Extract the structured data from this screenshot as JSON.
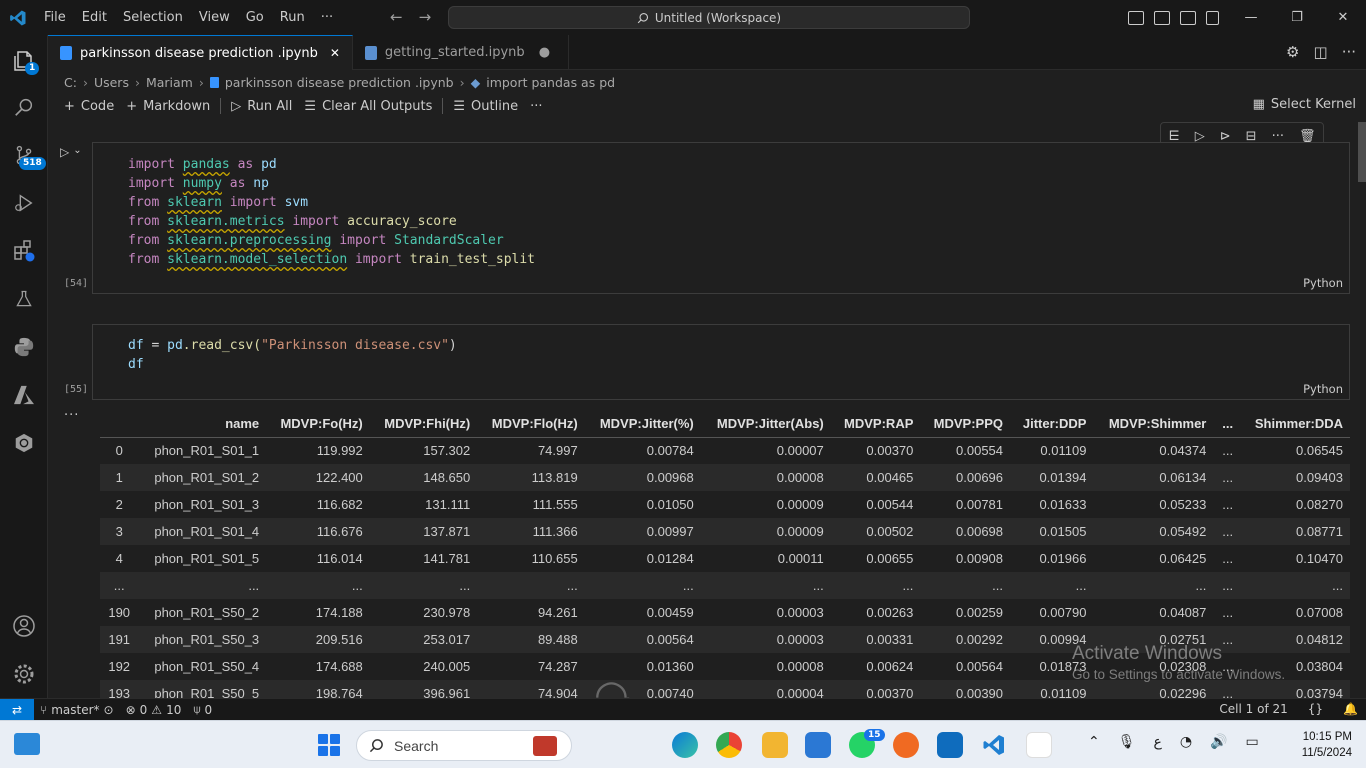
{
  "menu": [
    "File",
    "Edit",
    "Selection",
    "View",
    "Go",
    "Run",
    "···"
  ],
  "search": {
    "text": "Untitled (Workspace)"
  },
  "activity": {
    "explorer_badge": "1",
    "scm_badge": "518"
  },
  "tabs": [
    {
      "label": "parkinsson disease prediction .ipynb",
      "close": "✕"
    },
    {
      "label": "getting_started.ipynb",
      "dirty": "●"
    }
  ],
  "breadcrumb": [
    "C:",
    "Users",
    "Mariam",
    "parkinsson disease prediction .ipynb",
    "import pandas as pd"
  ],
  "toolbar": {
    "code": "Code",
    "markdown": "Markdown",
    "run_all": "Run All",
    "clear": "Clear All Outputs",
    "outline": "Outline",
    "more": "···",
    "kernel": "Select Kernel"
  },
  "cell1": {
    "exec": "[54]",
    "lang": "Python",
    "lines": [
      [
        "kw:import",
        "mod:pandas",
        "kw:as",
        "var:pd"
      ],
      [
        "kw:import",
        "mod:numpy",
        "kw:as",
        "var:np"
      ],
      [
        "kw:from",
        "mod:sklearn",
        "kw:import",
        "var:svm"
      ],
      [
        "kw:from",
        "mod:sklearn.metrics",
        "kw:import",
        "fn:accuracy_score"
      ],
      [
        "kw:from",
        "mod:sklearn.preprocessing",
        "kw:import",
        "mod2:StandardScaler"
      ],
      [
        "kw:from",
        "mod:sklearn.model_selection",
        "kw:import",
        "fn:train_test_split"
      ]
    ]
  },
  "cell2": {
    "exec": "[55]",
    "lang": "Python",
    "line1_var": "df",
    "line1_op": " = ",
    "line1_obj": "pd",
    "line1_fn": ".read_csv(",
    "line1_str": "\"Parkinsson disease.csv\"",
    "line1_end": ")",
    "line2": "df"
  },
  "output_more": "···",
  "table": {
    "headers": [
      "",
      "name",
      "MDVP:Fo(Hz)",
      "MDVP:Fhi(Hz)",
      "MDVP:Flo(Hz)",
      "MDVP:Jitter(%)",
      "MDVP:Jitter(Abs)",
      "MDVP:RAP",
      "MDVP:PPQ",
      "Jitter:DDP",
      "MDVP:Shimmer",
      "...",
      "Shimmer:DDA"
    ],
    "rows": [
      [
        "0",
        "phon_R01_S01_1",
        "119.992",
        "157.302",
        "74.997",
        "0.00784",
        "0.00007",
        "0.00370",
        "0.00554",
        "0.01109",
        "0.04374",
        "...",
        "0.06545"
      ],
      [
        "1",
        "phon_R01_S01_2",
        "122.400",
        "148.650",
        "113.819",
        "0.00968",
        "0.00008",
        "0.00465",
        "0.00696",
        "0.01394",
        "0.06134",
        "...",
        "0.09403"
      ],
      [
        "2",
        "phon_R01_S01_3",
        "116.682",
        "131.111",
        "111.555",
        "0.01050",
        "0.00009",
        "0.00544",
        "0.00781",
        "0.01633",
        "0.05233",
        "...",
        "0.08270"
      ],
      [
        "3",
        "phon_R01_S01_4",
        "116.676",
        "137.871",
        "111.366",
        "0.00997",
        "0.00009",
        "0.00502",
        "0.00698",
        "0.01505",
        "0.05492",
        "...",
        "0.08771"
      ],
      [
        "4",
        "phon_R01_S01_5",
        "116.014",
        "141.781",
        "110.655",
        "0.01284",
        "0.00011",
        "0.00655",
        "0.00908",
        "0.01966",
        "0.06425",
        "...",
        "0.10470"
      ],
      [
        "...",
        "...",
        "...",
        "...",
        "...",
        "...",
        "...",
        "...",
        "...",
        "...",
        "...",
        "...",
        "..."
      ],
      [
        "190",
        "phon_R01_S50_2",
        "174.188",
        "230.978",
        "94.261",
        "0.00459",
        "0.00003",
        "0.00263",
        "0.00259",
        "0.00790",
        "0.04087",
        "...",
        "0.07008"
      ],
      [
        "191",
        "phon_R01_S50_3",
        "209.516",
        "253.017",
        "89.488",
        "0.00564",
        "0.00003",
        "0.00331",
        "0.00292",
        "0.00994",
        "0.02751",
        "...",
        "0.04812"
      ],
      [
        "192",
        "phon_R01_S50_4",
        "174.688",
        "240.005",
        "74.287",
        "0.01360",
        "0.00008",
        "0.00624",
        "0.00564",
        "0.01873",
        "0.02308",
        "...",
        "0.03804"
      ],
      [
        "193",
        "phon_R01_S50_5",
        "198.764",
        "396.961",
        "74.904",
        "0.00740",
        "0.00004",
        "0.00370",
        "0.00390",
        "0.01109",
        "0.02296",
        "...",
        "0.03794"
      ]
    ]
  },
  "watermark": {
    "line1": "Activate Windows",
    "line2": "Go to Settings to activate Windows."
  },
  "status": {
    "branch": "master*",
    "problems": "0",
    "warnings": "10",
    "ports": "0",
    "cell": "Cell 1 of 21"
  },
  "taskbar": {
    "search": "Search",
    "whatsapp_badge": "15",
    "lang": "ع",
    "time": "10:15 PM",
    "date": "11/5/2024"
  },
  "colors": {
    "accent": "#0078d4",
    "keyword": "#c586c0",
    "module": "#4ec9b0",
    "function": "#dcdcaa",
    "string": "#ce9178"
  }
}
